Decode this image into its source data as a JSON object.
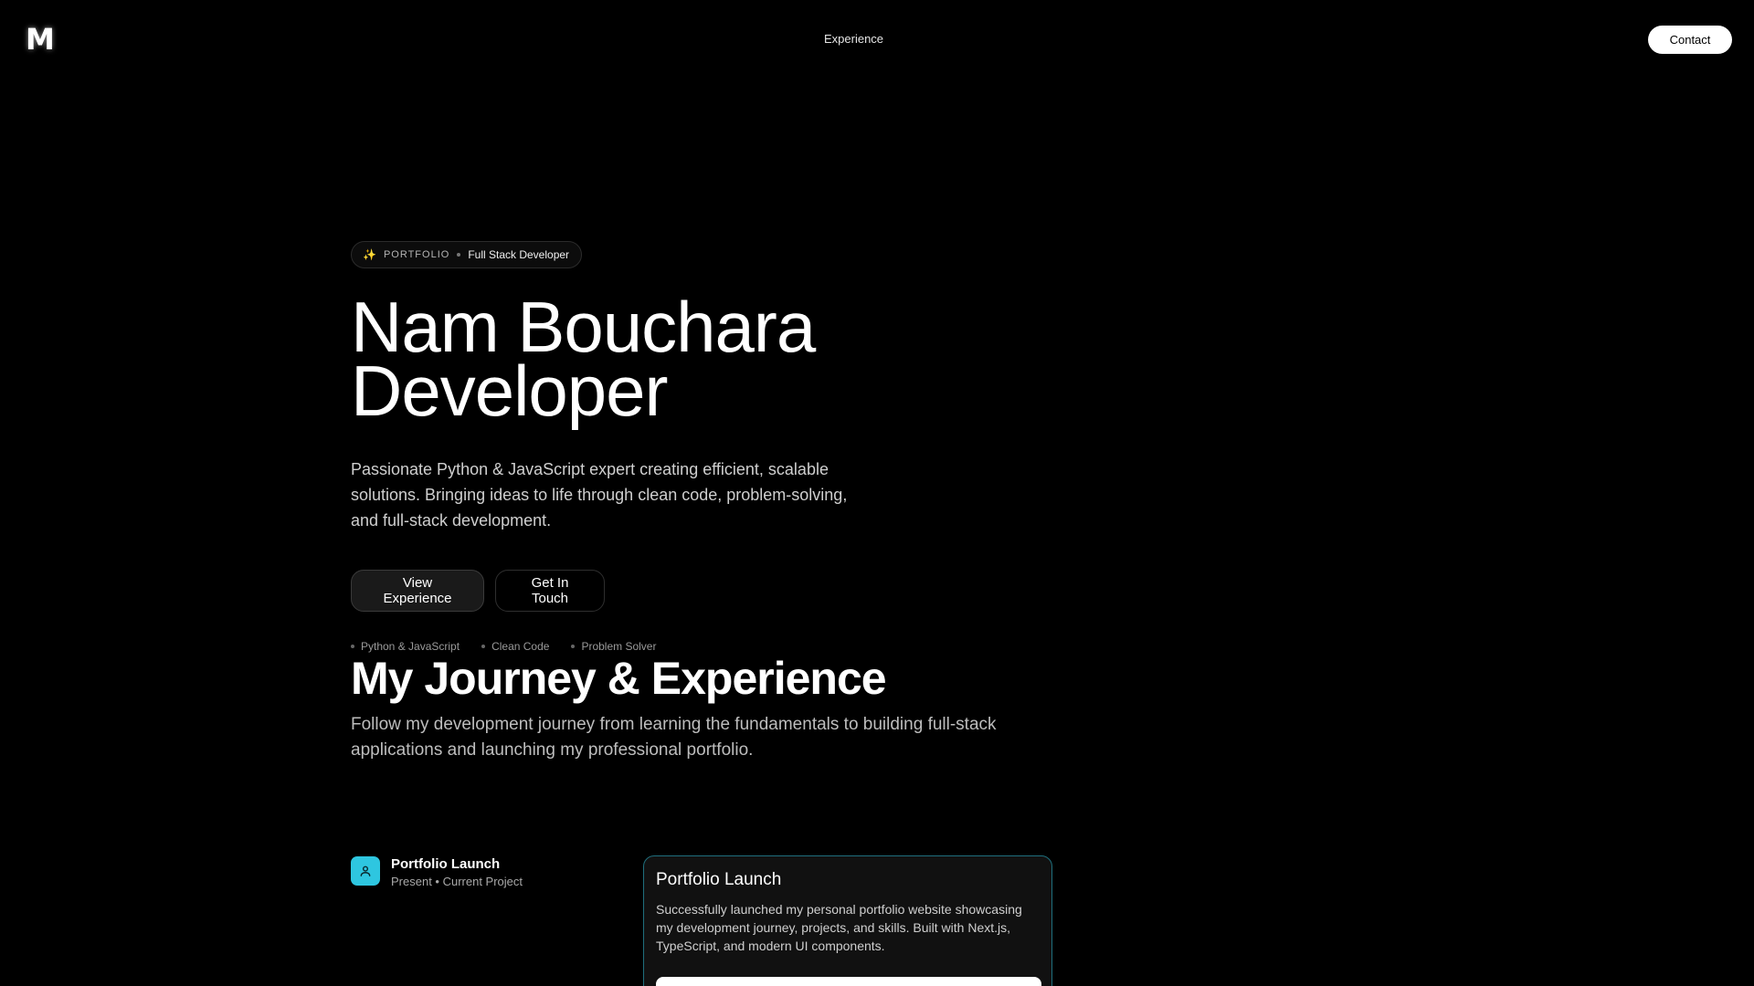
{
  "nav": {
    "logo": "M",
    "link": "Experience",
    "contact_label": "Contact"
  },
  "hero": {
    "badge_tag": "PORTFOLIO",
    "badge_role": "Full Stack Developer",
    "title_line1": "Nam Bouchara",
    "title_line2": "Developer",
    "description": "Passionate Python & JavaScript expert creating efficient, scalable solutions. Bringing ideas to life through clean code, problem-solving, and full-stack development.",
    "primary_cta": "View Experience",
    "secondary_cta": "Get In Touch",
    "tags": [
      "Python & JavaScript",
      "Clean Code",
      "Problem Solver"
    ]
  },
  "journey": {
    "title": "My Journey & Experience",
    "description": "Follow my development journey from learning the fundamentals to building full-stack applications and launching my professional portfolio.",
    "item": {
      "icon": "user-icon",
      "title": "Portfolio Launch",
      "subtitle": "Present • Current Project",
      "card_title": "Portfolio Launch",
      "card_text": "Successfully launched my personal portfolio website showcasing my development journey, projects, and skills. Built with Next.js, TypeScript, and modern UI components."
    }
  },
  "colors": {
    "background": "#000000",
    "accent": "#2ec6e0",
    "card_border": "#1f6f7d"
  }
}
